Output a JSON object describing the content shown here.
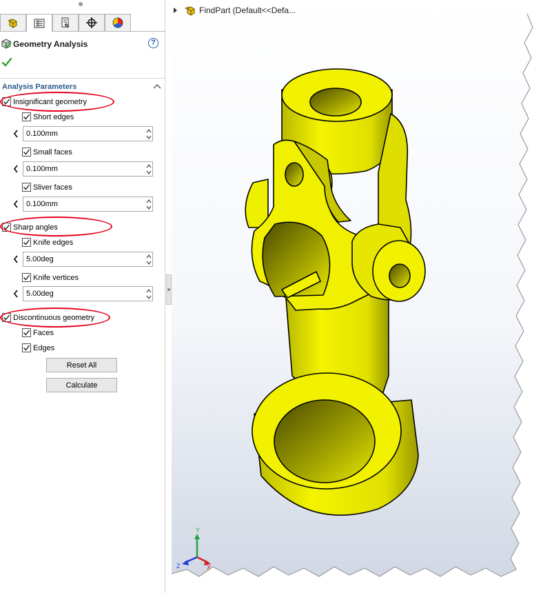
{
  "panel": {
    "title": "Geometry Analysis",
    "help_label": "?",
    "tabs": [
      {
        "name": "feature-manager",
        "icon": "part-cube-icon"
      },
      {
        "name": "property-manager",
        "icon": "property-list-icon"
      },
      {
        "name": "configuration-manager",
        "icon": "configuration-icon"
      },
      {
        "name": "dimxpert-manager",
        "icon": "crosshair-icon"
      },
      {
        "name": "display-manager",
        "icon": "color-wheel-icon"
      }
    ],
    "active_tab": "property-manager",
    "section_title": "Analysis Parameters",
    "insignificant": {
      "label": "Insignificant geometry",
      "checked": true,
      "short_edges": {
        "label": "Short edges",
        "checked": true,
        "value": "0.100mm"
      },
      "small_faces": {
        "label": "Small faces",
        "checked": true,
        "value": "0.100mm"
      },
      "sliver_faces": {
        "label": "Sliver faces",
        "checked": true,
        "value": "0.100mm"
      }
    },
    "sharp": {
      "label": "Sharp angles",
      "checked": true,
      "knife_edges": {
        "label": "Knife edges",
        "checked": true,
        "value": "5.00deg"
      },
      "knife_vertices": {
        "label": "Knife vertices",
        "checked": true,
        "value": "5.00deg"
      }
    },
    "discontinuous": {
      "label": "Discontinuous geometry",
      "checked": true,
      "faces": {
        "label": "Faces",
        "checked": true
      },
      "edges": {
        "label": "Edges",
        "checked": true
      }
    },
    "reset_label": "Reset All",
    "calculate_label": "Calculate"
  },
  "tree": {
    "part_name": "FindPart  (Default<<Defa..."
  },
  "model": {
    "fill": "#f2f200",
    "shade": "#b8b800",
    "dark": "#6f6f00"
  },
  "triad": {
    "x_label": "X",
    "y_label": "Y",
    "z_label": "Z"
  },
  "colors": {
    "annotation": "#e3001b",
    "section_title": "#2d5a8a",
    "check": "#2ea02e",
    "viewport_top": "#ffffff",
    "viewport_bottom": "#cfd6e3"
  }
}
